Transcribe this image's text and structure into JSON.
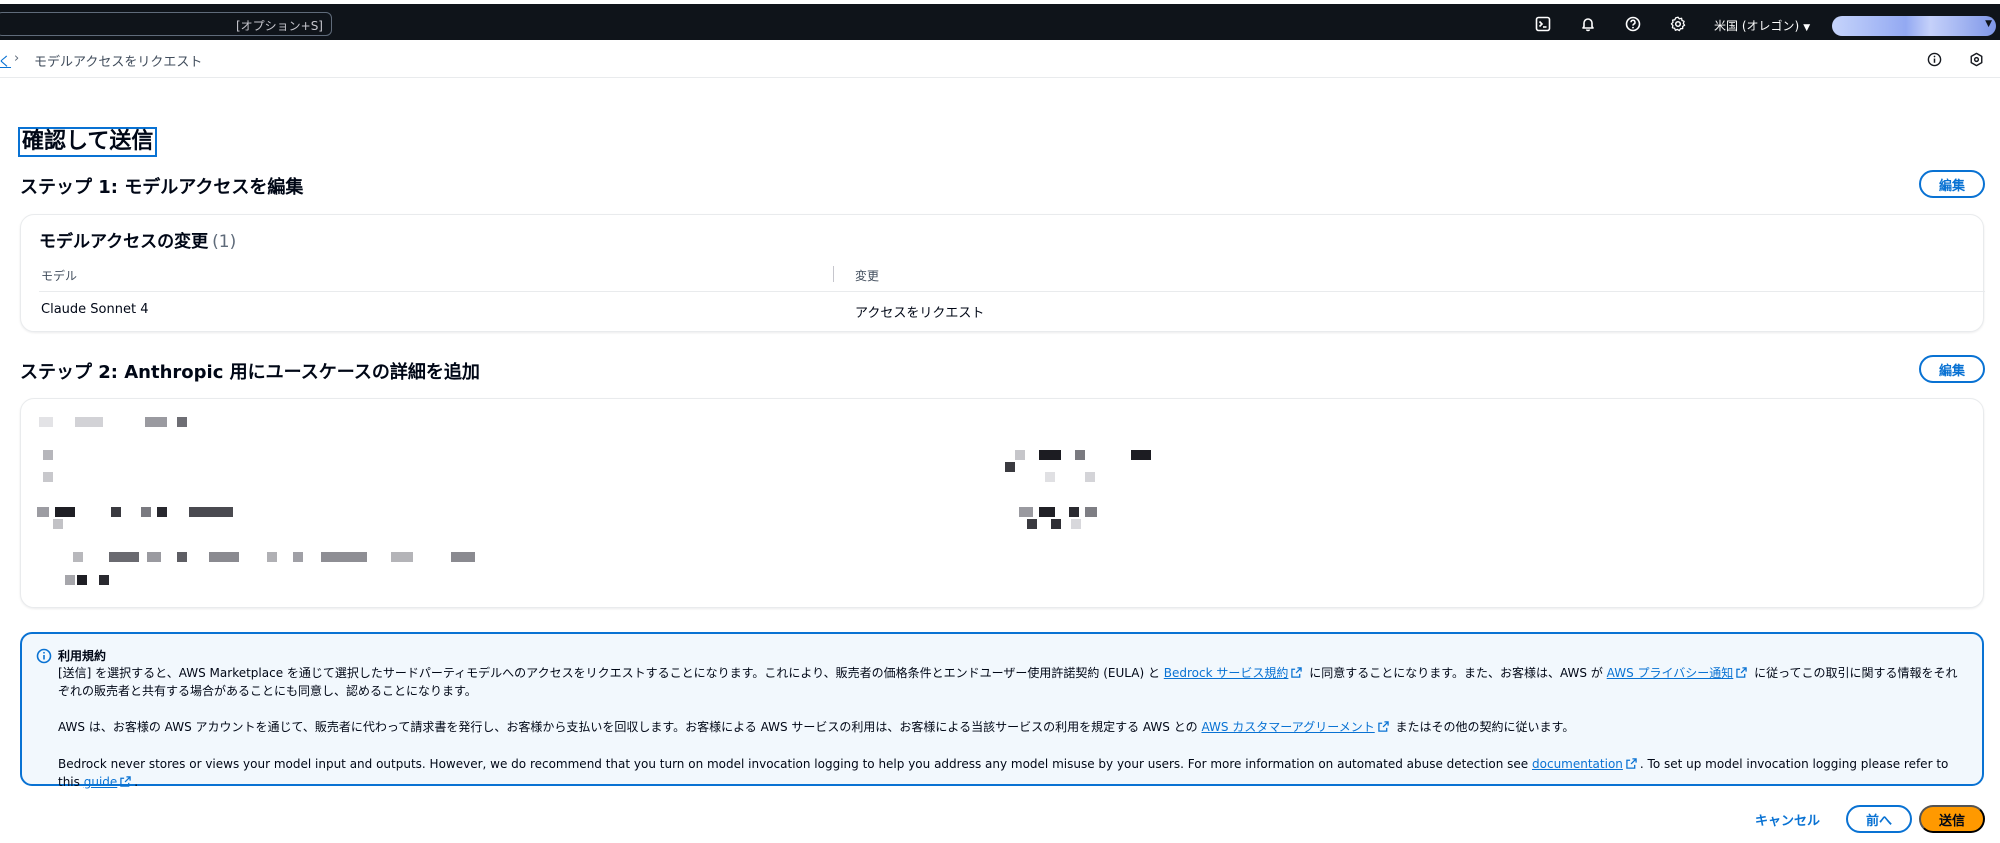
{
  "topnav": {
    "search_shortcut": "[オプション+S]",
    "region_label": "米国 (オレゴン)",
    "icons": [
      "cloudshell-icon",
      "bell-icon",
      "help-icon",
      "settings-icon"
    ]
  },
  "breadcrumb": {
    "parent_label": "く",
    "current_label": "モデルアクセスをリクエスト"
  },
  "page": {
    "title": "確認して送信"
  },
  "step1": {
    "title": "ステップ 1: モデルアクセスを編集",
    "edit_label": "編集",
    "card_title": "モデルアクセスの変更",
    "card_count": "(1)",
    "columns": [
      "モデル",
      "変更"
    ],
    "rows": [
      {
        "model": "Claude Sonnet 4",
        "change": "アクセスをリクエスト"
      }
    ]
  },
  "step2": {
    "title": "ステップ 2: Anthropic 用にユースケースの詳細を追加",
    "edit_label": "編集"
  },
  "terms": {
    "heading": "利用規約",
    "p1_a": "[送信] を選択すると、AWS Marketplace を通じて選択したサードパーティモデルへのアクセスをリクエストすることになります。これにより、販売者の価格条件とエンドユーザー使用許諾契約 (EULA) と ",
    "p1_link1": "Bedrock サービス規約",
    "p1_b": " に同意することになります。また、お客様は、AWS が ",
    "p1_link2": "AWS プライバシー通知",
    "p1_c": " に従ってこの取引に関する情報をそれぞれの販売者と共有する場合があることにも同意し、認めることになります。",
    "p2_a": "AWS は、お客様の AWS アカウントを通じて、販売者に代わって請求書を発行し、お客様から支払いを回収します。お客様による AWS サービスの利用は、お客様による当該サービスの利用を規定する AWS との ",
    "p2_link": "AWS カスタマーアグリーメント",
    "p2_b": " またはその他の契約に従います。",
    "p3_a": "Bedrock never stores or views your model input and outputs. However, we do recommend that you turn on model invocation logging to help you address any model misuse by your users. For more information on automated abuse detection see ",
    "p3_link1": "documentation",
    "p3_b": ". To set up model invocation logging please refer to this ",
    "p3_link2": "guide",
    "p3_c": "."
  },
  "footer": {
    "cancel_label": "キャンセル",
    "prev_label": "前へ",
    "submit_label": "送信"
  },
  "colors": {
    "nav_bg": "#0f141a",
    "link": "#0972d3",
    "primary_button": "#ff9900",
    "alert_bg": "#f2f8fd"
  }
}
